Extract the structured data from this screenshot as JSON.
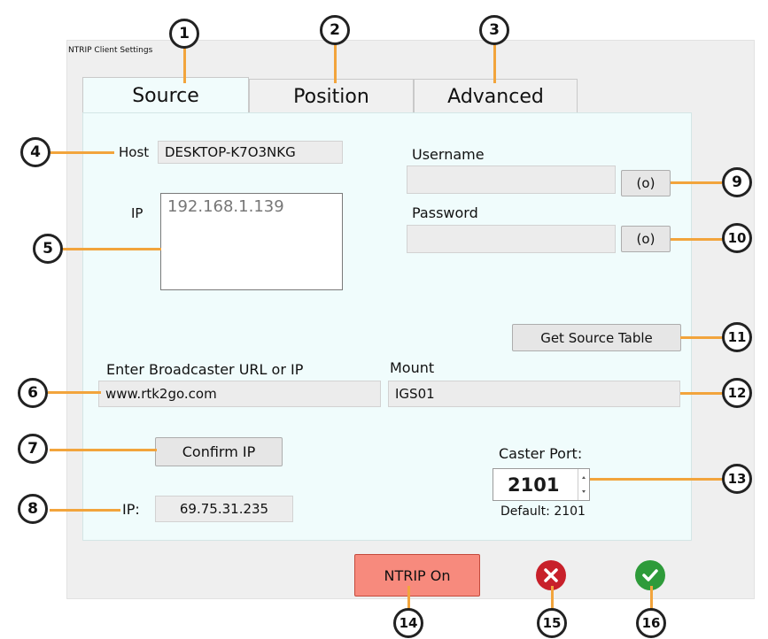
{
  "window": {
    "title": "NTRIP Client Settings"
  },
  "tabs": [
    {
      "label": "Source",
      "active": true
    },
    {
      "label": "Position",
      "active": false
    },
    {
      "label": "Advanced",
      "active": false
    }
  ],
  "source": {
    "host_label": "Host",
    "host_value": "DESKTOP-K7O3NKG",
    "ip_label": "IP",
    "ip_list_value": "192.168.1.139",
    "username_label": "Username",
    "username_value": "",
    "password_label": "Password",
    "password_value": "",
    "show_username_button": "(o)",
    "show_password_button": "(o)",
    "get_source_table_button": "Get Source Table",
    "broadcaster_label": "Enter Broadcaster URL or IP",
    "broadcaster_value": "www.rtk2go.com",
    "mount_label": "Mount",
    "mount_value": "IGS01",
    "confirm_ip_button": "Confirm IP",
    "resolved_ip_label": "IP:",
    "resolved_ip_value": "69.75.31.235",
    "caster_port_label": "Caster Port:",
    "caster_port_value": "2101",
    "caster_port_default": "Default: 2101"
  },
  "footer": {
    "ntrip_button": "NTRIP On",
    "cancel_icon": "x-circle-icon",
    "ok_icon": "check-circle-icon"
  },
  "callouts": [
    "1",
    "2",
    "3",
    "4",
    "5",
    "6",
    "7",
    "8",
    "9",
    "10",
    "11",
    "12",
    "13",
    "14",
    "15",
    "16"
  ],
  "colors": {
    "callout_line": "#f2a43c",
    "panel_bg": "#f0fcfc",
    "ntrip_button": "#f78a7d",
    "cancel": "#c8202a",
    "ok": "#2e9b3a"
  }
}
